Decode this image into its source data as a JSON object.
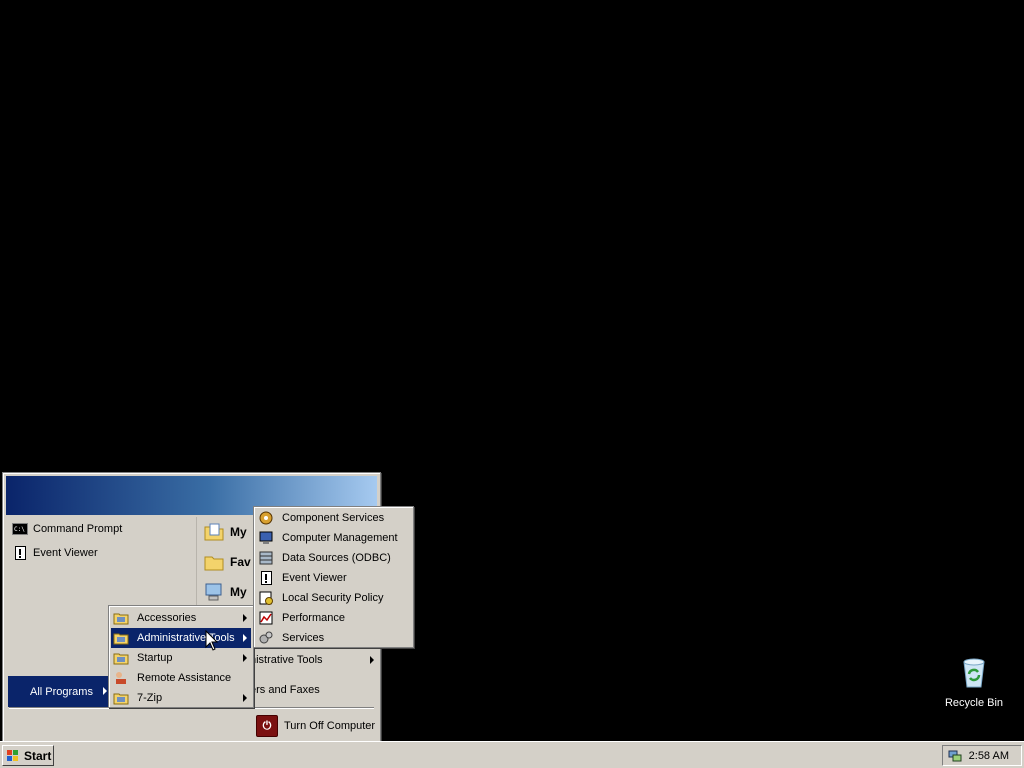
{
  "desktop": {
    "recycle_bin_label": "Recycle Bin"
  },
  "start_menu": {
    "pinned": [
      {
        "label": "Command Prompt",
        "icon": "cmd-icon"
      },
      {
        "label": "Event Viewer",
        "icon": "event-viewer-icon"
      }
    ],
    "right_items": [
      {
        "label": "My",
        "icon": "my-documents-icon"
      },
      {
        "label": "Fav",
        "icon": "favorites-folder-icon"
      },
      {
        "label": "My",
        "icon": "my-computer-icon"
      },
      {
        "label": "nistrative Tools",
        "icon": "admin-tools-icon"
      },
      {
        "label": "ers and Faxes",
        "icon": "printers-icon"
      }
    ],
    "all_programs_label": "All Programs",
    "turn_off_label": "Turn Off Computer"
  },
  "programs_menu": {
    "items": [
      {
        "label": "Accessories",
        "submenu": true
      },
      {
        "label": "Administrative Tools",
        "submenu": true,
        "highlighted": true
      },
      {
        "label": "Startup",
        "submenu": true
      },
      {
        "label": "Remote Assistance",
        "submenu": false
      },
      {
        "label": "7-Zip",
        "submenu": true
      }
    ]
  },
  "admin_tools_menu": {
    "items": [
      {
        "label": "Component Services",
        "icon": "component-services-icon"
      },
      {
        "label": "Computer Management",
        "icon": "computer-management-icon"
      },
      {
        "label": "Data Sources (ODBC)",
        "icon": "odbc-icon"
      },
      {
        "label": "Event Viewer",
        "icon": "event-viewer-icon"
      },
      {
        "label": "Local Security Policy",
        "icon": "security-policy-icon"
      },
      {
        "label": "Performance",
        "icon": "performance-icon"
      },
      {
        "label": "Services",
        "icon": "services-icon"
      }
    ]
  },
  "taskbar": {
    "start_label": "Start",
    "clock": "2:58 AM"
  },
  "colors": {
    "desktop": "#000000",
    "face": "#d4d0c8",
    "highlight": "#0a246a"
  }
}
